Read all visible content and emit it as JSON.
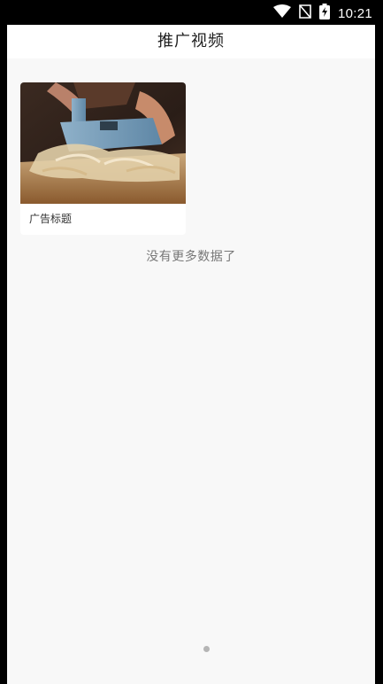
{
  "status_bar": {
    "time": "10:21",
    "icons": [
      "wifi-icon",
      "no-sim-icon",
      "battery-charging-icon"
    ]
  },
  "header": {
    "title": "推广视频"
  },
  "video_list": {
    "items": [
      {
        "title": "广告标题",
        "thumbnail": "wood-planing-image"
      }
    ],
    "end_message": "没有更多数据了"
  },
  "colors": {
    "background": "#f8f8f8",
    "header_bg": "#ffffff",
    "title_text": "#1f1f1f",
    "muted_text": "#777777"
  }
}
